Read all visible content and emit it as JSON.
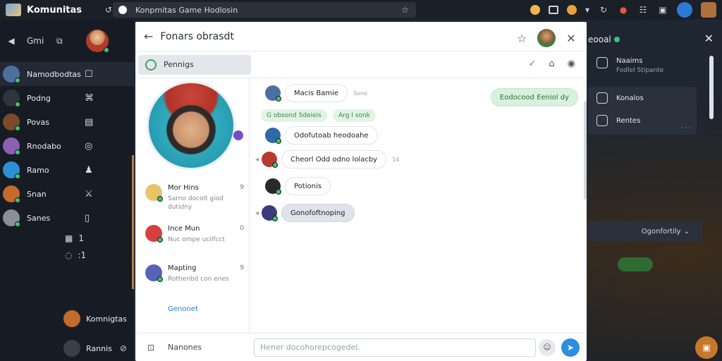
{
  "topbar": {
    "app_name": "Komunitas",
    "url_text": "Konpmitas Game Hodlosin"
  },
  "sidebar": {
    "top_label": "Gmi",
    "items": [
      {
        "label": "Namodbodtas",
        "color": "#4d6fa0",
        "active": true,
        "icon": "☐"
      },
      {
        "label": "Podng",
        "color": "#2e3440",
        "active": false,
        "icon": "⌘"
      },
      {
        "label": "Povas",
        "color": "#7b4a2b",
        "active": false,
        "icon": "▤"
      },
      {
        "label": "Rnodabo",
        "color": "#8d5fb3",
        "active": false,
        "icon": "◎"
      },
      {
        "label": "Ramo",
        "color": "#2f8fd6",
        "active": false,
        "icon": "♟"
      },
      {
        "label": "Snan",
        "color": "#c26b2a",
        "active": false,
        "icon": "⚔"
      },
      {
        "label": "Sanes",
        "color": "#8b8f96",
        "active": false,
        "icon": "▯"
      }
    ],
    "extra": [
      {
        "icon": "▦",
        "value": "1"
      },
      {
        "icon": "◌",
        "value": ":1"
      }
    ],
    "bottom": [
      {
        "label": "Komnigtas"
      },
      {
        "label": "Rannis"
      }
    ]
  },
  "window": {
    "title": "Fonars obrasdt",
    "pill_label": "Pennigs",
    "profile_link": "Genonet",
    "contacts": [
      {
        "name": "Mor Hins",
        "sub": "Sarno docolt giod dutidny",
        "tick": "9",
        "color": "#e7c36a"
      },
      {
        "name": "Ince Mun",
        "sub": "Nuc ompe ucilfcct",
        "tick": "0",
        "color": "#d74040"
      },
      {
        "name": "Mapting",
        "sub": "Rothenbd con enes",
        "tick": "9",
        "color": "#5563b8"
      }
    ],
    "messages": [
      {
        "text": "Macis Bamie",
        "color": "#4d6fa0",
        "style": "plain",
        "time": "Sono"
      },
      {
        "text": "Odofutoab heodoahe",
        "color": "#2e6aa8",
        "style": "plain",
        "time": ""
      },
      {
        "text": "Cheorl Odd odno lolacby",
        "color": "#b93a32",
        "style": "plain",
        "time": "14"
      },
      {
        "text": "Potionis",
        "color": "#2a2a2a",
        "style": "plain",
        "time": ""
      },
      {
        "text": "Gonofoftnoping",
        "color": "#3c3a7a",
        "style": "grey",
        "time": ""
      }
    ],
    "outgoing": "Eodocood Eeniol dy",
    "tags": [
      "G obsond  Sdeieis",
      "Arg I sonk"
    ],
    "composer_left": "Nanones",
    "composer_placeholder": "Hener docohorepcogedel."
  },
  "right_panel": {
    "title": "eooal",
    "row1_main": "Naaims",
    "row1_sub": "Fodlel Stipante",
    "card_items": [
      "Konalos",
      "Rentes"
    ],
    "card_more": "· · ·",
    "option_label": "Ogonfortily"
  }
}
